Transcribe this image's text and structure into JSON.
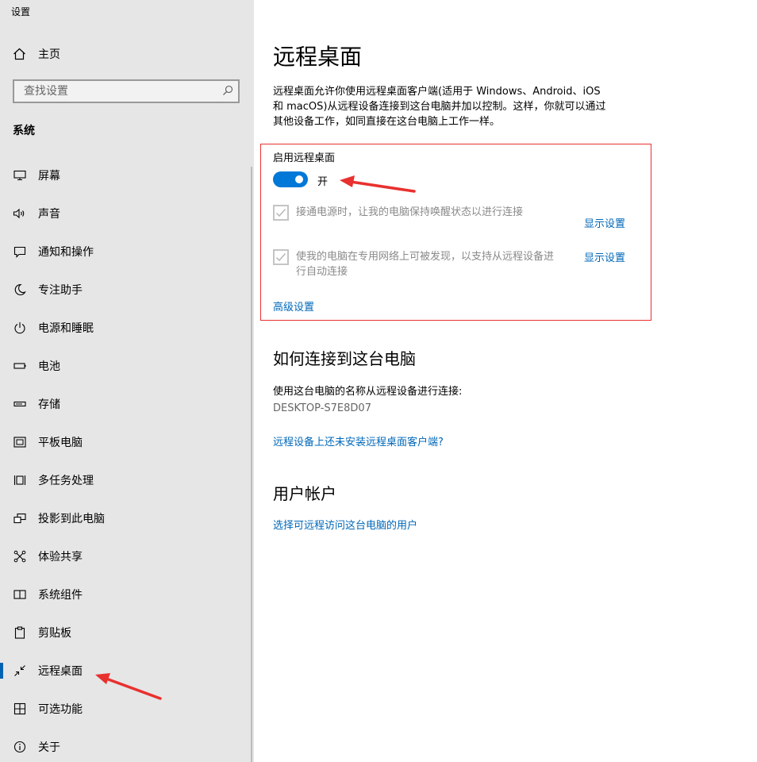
{
  "app": {
    "title": "设置"
  },
  "sidebar": {
    "home_label": "主页",
    "search_placeholder": "查找设置",
    "section_title": "系统",
    "items": [
      {
        "label": "屏幕",
        "icon": "monitor-icon"
      },
      {
        "label": "声音",
        "icon": "speaker-icon"
      },
      {
        "label": "通知和操作",
        "icon": "notification-icon"
      },
      {
        "label": "专注助手",
        "icon": "moon-icon"
      },
      {
        "label": "电源和睡眠",
        "icon": "power-icon"
      },
      {
        "label": "电池",
        "icon": "battery-icon"
      },
      {
        "label": "存储",
        "icon": "storage-icon"
      },
      {
        "label": "平板电脑",
        "icon": "tablet-icon"
      },
      {
        "label": "多任务处理",
        "icon": "multitask-icon"
      },
      {
        "label": "投影到此电脑",
        "icon": "project-icon"
      },
      {
        "label": "体验共享",
        "icon": "shared-experience-icon"
      },
      {
        "label": "系统组件",
        "icon": "components-icon"
      },
      {
        "label": "剪贴板",
        "icon": "clipboard-icon"
      },
      {
        "label": "远程桌面",
        "icon": "remote-desktop-icon",
        "active": true
      },
      {
        "label": "可选功能",
        "icon": "optional-features-icon"
      },
      {
        "label": "关于",
        "icon": "info-icon"
      }
    ]
  },
  "main": {
    "title": "远程桌面",
    "description_line1": "远程桌面允许你使用远程桌面客户端(适用于 Windows、Android、iOS",
    "description_line2": "和 macOS)从远程设备连接到这台电脑并加以控制。这样，你就可以通过",
    "description_line3": "其他设备工作，如同直接在这台电脑上工作一样。",
    "enable_label": "启用远程桌面",
    "toggle_state": "开",
    "toggle_on": true,
    "option1_text": "接通电源时，让我的电脑保持唤醒状态以进行连接",
    "option1_checked": true,
    "option1_link": "显示设置",
    "option2_text_line1": "使我的电脑在专用网络上可被发现，以支持从远程设备进",
    "option2_text_line2": "行自动连接",
    "option2_checked": true,
    "option2_link": "显示设置",
    "advanced_link": "高级设置",
    "connect_heading": "如何连接到这台电脑",
    "connect_text": "使用这台电脑的名称从远程设备进行连接:",
    "pc_name": "DESKTOP-S7E8D07",
    "client_link": "远程设备上还未安装远程桌面客户端?",
    "accounts_heading": "用户帐户",
    "accounts_link": "选择可远程访问这台电脑的用户"
  },
  "colors": {
    "accent": "#0078d7",
    "link": "#0067b8",
    "sidebar_bg": "#e6e6e6",
    "highlight_border": "#e8312f"
  }
}
